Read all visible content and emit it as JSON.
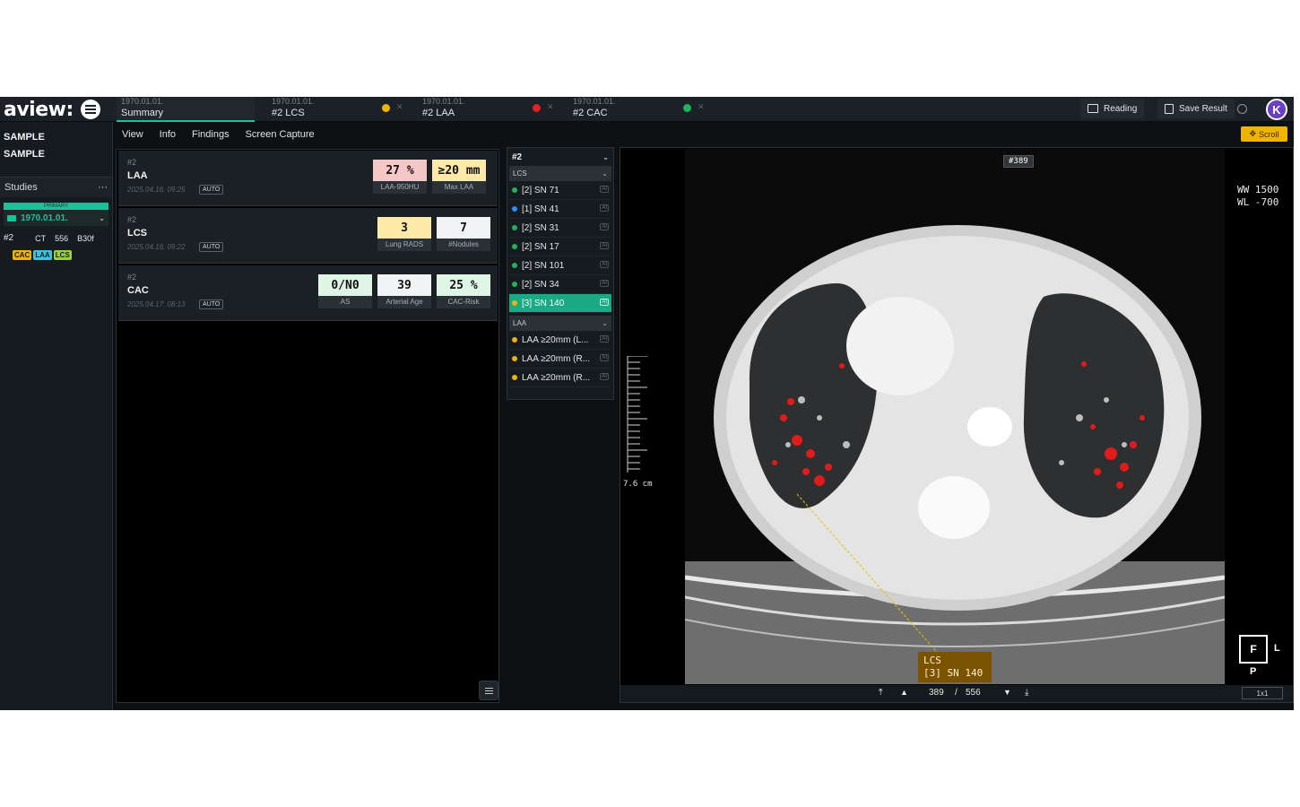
{
  "app": {
    "logo": "aview:"
  },
  "tabs": [
    {
      "date": "1970.01.01.",
      "name": "Summary"
    },
    {
      "date": "1970.01.01.",
      "name": "#2  LCS",
      "status_color": "#f0b400"
    },
    {
      "date": "1970.01.01.",
      "name": "#2  LAA",
      "status_color": "#e02424"
    },
    {
      "date": "1970.01.01.",
      "name": "#2  CAC",
      "status_color": "#1fb35c"
    }
  ],
  "toolbar": {
    "reading_label": "Reading",
    "save_label": "Save Result",
    "avatar_initial": "K",
    "scroll_label": "Scroll"
  },
  "patient": {
    "line1": "SAMPLE",
    "line2": "SAMPLE"
  },
  "studies": {
    "title": "Studies",
    "more": "···",
    "primary_label": "PRIMARY",
    "study_date": "1970.01.01.",
    "series": {
      "number": "#2",
      "modality": "CT",
      "images": "556",
      "kernel": "B30f"
    },
    "badges": [
      {
        "label": "CAC",
        "color": "#f0b400"
      },
      {
        "label": "LAA",
        "color": "#39c6e6"
      },
      {
        "label": "LCS",
        "color": "#9bd23c"
      }
    ]
  },
  "menu": {
    "items": [
      "View",
      "Info",
      "Findings",
      "Screen Capture"
    ]
  },
  "summary_cards": [
    {
      "series": "#2",
      "title": "LAA",
      "datetime": "2025.04.16. 09:25",
      "auto": "AUTO",
      "metrics": [
        {
          "value": "27 %",
          "label": "LAA-950HU",
          "color": "#f6c7c7"
        },
        {
          "value": "≥20 mm",
          "label": "Max LAA",
          "color": "#fde9a8"
        }
      ]
    },
    {
      "series": "#2",
      "title": "LCS",
      "datetime": "2025.04.16. 09:22",
      "auto": "AUTO",
      "metrics": [
        {
          "value": "3",
          "label": "Lung RADS",
          "color": "#fde9a8"
        },
        {
          "value": "7",
          "label": "#Nodules",
          "color": "#f2f3f4"
        }
      ]
    },
    {
      "series": "#2",
      "title": "CAC",
      "datetime": "2025.04.17. 08:13",
      "auto": "AUTO",
      "metrics": [
        {
          "value": "0/N0",
          "label": "AS",
          "color": "#dff5e6"
        },
        {
          "value": "39",
          "label": "Arterial Age",
          "color": "#f2f3f4"
        },
        {
          "value": "25 %",
          "label": "CAC-Risk",
          "color": "#dff5e6"
        }
      ]
    }
  ],
  "findings": {
    "series": "#2",
    "lcs_group": "LCS",
    "lcs_items": [
      {
        "label": "[2] SN 71",
        "color": "#1fb35c"
      },
      {
        "label": "[1] SN 41",
        "color": "#2d8cff"
      },
      {
        "label": "[2] SN 31",
        "color": "#1fb35c"
      },
      {
        "label": "[2] SN 17",
        "color": "#1fb35c"
      },
      {
        "label": "[2] SN 101",
        "color": "#1fb35c"
      },
      {
        "label": "[2] SN 34",
        "color": "#1fb35c"
      },
      {
        "label": "[3] SN 140",
        "color": "#f0b400"
      }
    ],
    "laa_group": "LAA",
    "laa_items": [
      {
        "label": "LAA ≥20mm (L...",
        "color": "#f0b400"
      },
      {
        "label": "LAA ≥20mm (R...",
        "color": "#f0b400"
      },
      {
        "label": "LAA ≥20mm (R...",
        "color": "#f0b400"
      }
    ],
    "ai_tag": "AI"
  },
  "viewer": {
    "slice_tag": "#389",
    "ww": "WW 1500",
    "wl": "WL -700",
    "ruler_label": "7.6 cm",
    "annotation_line1": "LCS",
    "annotation_line2": "[3] SN 140",
    "orientation_main": "F",
    "orientation_right": "L",
    "orientation_bottom": "P",
    "current_slice": "389",
    "slice_sep": "/",
    "total_slices": "556",
    "layout": "1x1"
  }
}
